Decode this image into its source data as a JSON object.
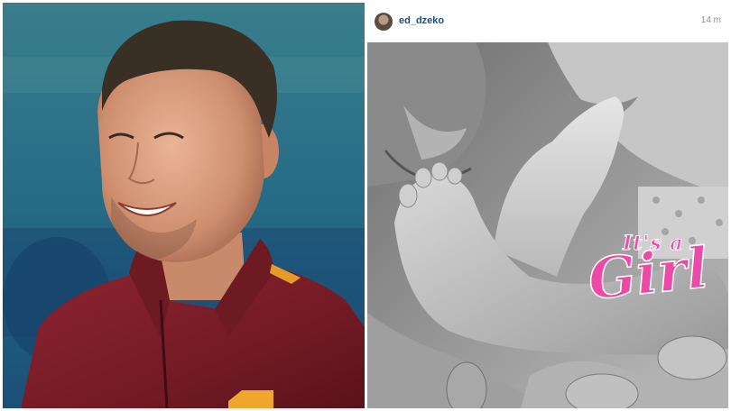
{
  "post": {
    "username": "ed_dzeko",
    "timestamp": "14 m"
  },
  "sticker": {
    "line1": "It's a",
    "line2": "Girl"
  },
  "colors": {
    "username": "#1d4f7c",
    "sticker_pink": "#ec4aa6",
    "jersey": "#7a1c24"
  },
  "icons": {
    "avatar": "profile-avatar"
  }
}
